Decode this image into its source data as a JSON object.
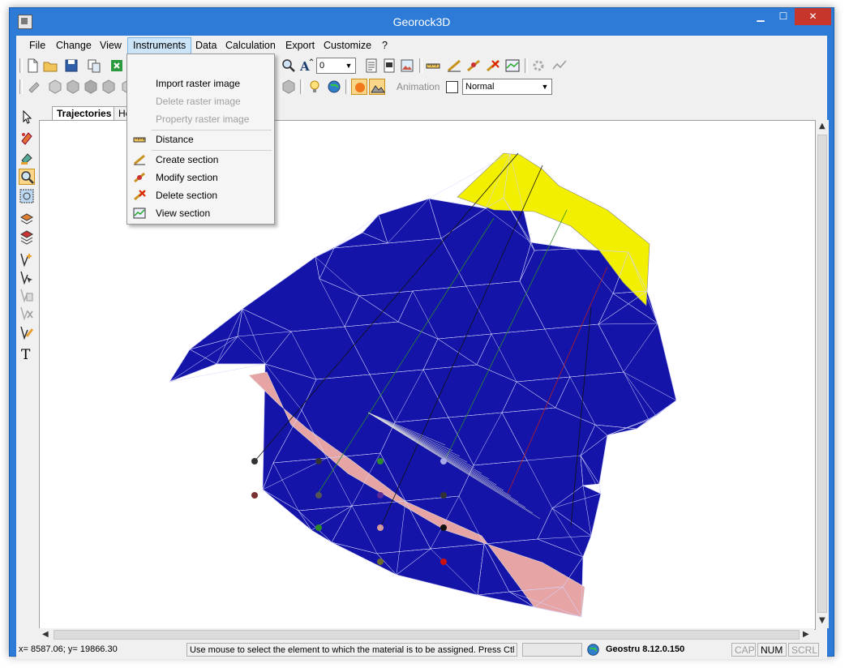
{
  "window": {
    "title": "Georock3D",
    "min_label": "▁",
    "max_label": "☐",
    "close_label": "✕"
  },
  "menu": {
    "items": [
      "File",
      "Change",
      "View",
      "Instruments",
      "Data",
      "Calculation",
      "Export",
      "Customize",
      "?"
    ]
  },
  "toolbar": {
    "font_size_value": "0",
    "animation_label": "Animation",
    "render_mode_value": "Normal"
  },
  "tabs": [
    "Trajectories",
    "Heig"
  ],
  "instruments_menu": {
    "items": [
      {
        "label": "Import raster image",
        "enabled": true
      },
      {
        "label": "Delete raster image",
        "enabled": false
      },
      {
        "label": "Property raster image",
        "enabled": false
      },
      {
        "label": "Distance",
        "enabled": true
      },
      {
        "label": "Create section",
        "enabled": true
      },
      {
        "label": "Modify section",
        "enabled": true
      },
      {
        "label": "Delete section",
        "enabled": true
      },
      {
        "label": "View section",
        "enabled": true
      }
    ]
  },
  "status": {
    "coords": "x= 8587.06; y= 19866.30",
    "hint": "Use mouse to select the element to which the material is to be assigned. Press Ctl fo",
    "product": "Geostru 8.12.0.150",
    "cap": "CAP",
    "num": "NUM",
    "scrl": "SCRL"
  },
  "colors": {
    "terrain": "#1414a8",
    "yellow_zone": "#f2ef00",
    "pink_band": "#e6a4a4",
    "accent_title": "#2d7bd6",
    "close": "#c7362b"
  }
}
